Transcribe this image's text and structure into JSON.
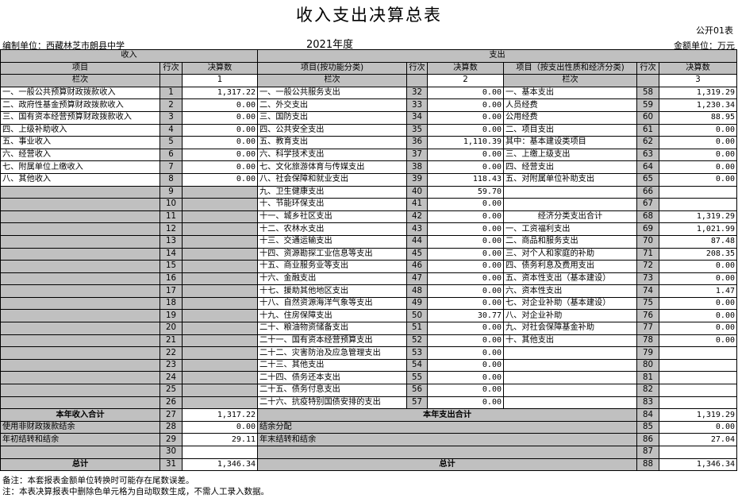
{
  "title": "收入支出决算总表",
  "form_code": "公开01表",
  "unit_label": "编制单位：西藏林芝市朗县中学",
  "year": "2021年度",
  "amount_unit": "金额单位：万元",
  "header": {
    "income": "收入",
    "expense": "支出",
    "item": "项目",
    "row_no": "行次",
    "amount": "决算数",
    "item_func": "项目(按功能分类)",
    "item_econ": "项目（按支出性质和经济分类)",
    "col_label": "栏次",
    "col1": "1",
    "col2": "2",
    "col3": "3"
  },
  "rows": [
    {
      "i_name": "一、一般公共预算财政拨款收入",
      "i_no": "1",
      "i_amt": "1,317.22",
      "f_name": "一、一般公共服务支出",
      "f_no": "32",
      "f_amt": "0.00",
      "e_name": "一、基本支出",
      "e_no": "58",
      "e_amt": "1,319.29"
    },
    {
      "i_name": "二、政府性基金预算财政拨款收入",
      "i_no": "2",
      "i_amt": "0.00",
      "f_name": "二、外交支出",
      "f_no": "33",
      "f_amt": "0.00",
      "e_name": "人员经费",
      "e_no": "59",
      "e_amt": "1,230.34",
      "e_indent": true
    },
    {
      "i_name": "三、国有资本经营预算财政拨款收入",
      "i_no": "3",
      "i_amt": "0.00",
      "f_name": "三、国防支出",
      "f_no": "34",
      "f_amt": "0.00",
      "e_name": "公用经费",
      "e_no": "60",
      "e_amt": "88.95",
      "e_indent": true
    },
    {
      "i_name": "四、上级补助收入",
      "i_no": "4",
      "i_amt": "0.00",
      "f_name": "四、公共安全支出",
      "f_no": "35",
      "f_amt": "0.00",
      "e_name": "二、项目支出",
      "e_no": "61",
      "e_amt": "0.00"
    },
    {
      "i_name": "五、事业收入",
      "i_no": "5",
      "i_amt": "0.00",
      "f_name": "五、教育支出",
      "f_no": "36",
      "f_amt": "1,110.39",
      "e_name": "其中：基本建设类项目",
      "e_no": "62",
      "e_amt": "0.00",
      "e_indent": true
    },
    {
      "i_name": "六、经营收入",
      "i_no": "6",
      "i_amt": "0.00",
      "f_name": "六、科学技术支出",
      "f_no": "37",
      "f_amt": "0.00",
      "e_name": "三、上缴上级支出",
      "e_no": "63",
      "e_amt": "0.00"
    },
    {
      "i_name": "七、附属单位上缴收入",
      "i_no": "7",
      "i_amt": "0.00",
      "f_name": "七、文化旅游体育与传媒支出",
      "f_no": "38",
      "f_amt": "0.00",
      "e_name": "四、经营支出",
      "e_no": "64",
      "e_amt": "0.00"
    },
    {
      "i_name": "八、其他收入",
      "i_no": "8",
      "i_amt": "0.00",
      "f_name": "八、社会保障和就业支出",
      "f_no": "39",
      "f_amt": "118.43",
      "e_name": "五、对附属单位补助支出",
      "e_no": "65",
      "e_amt": "0.00"
    },
    {
      "i_name": "",
      "i_no": "9",
      "i_amt": "",
      "f_name": "九、卫生健康支出",
      "f_no": "40",
      "f_amt": "59.70",
      "e_name": "",
      "e_no": "66",
      "e_amt": ""
    },
    {
      "i_name": "",
      "i_no": "10",
      "i_amt": "",
      "f_name": "十、节能环保支出",
      "f_no": "41",
      "f_amt": "0.00",
      "e_name": "",
      "e_no": "67",
      "e_amt": ""
    },
    {
      "i_name": "",
      "i_no": "11",
      "i_amt": "",
      "f_name": "十一、城乡社区支出",
      "f_no": "42",
      "f_amt": "0.00",
      "e_name": "经济分类支出合计",
      "e_no": "68",
      "e_amt": "1,319.29",
      "e_center": true
    },
    {
      "i_name": "",
      "i_no": "12",
      "i_amt": "",
      "f_name": "十二、农林水支出",
      "f_no": "43",
      "f_amt": "0.00",
      "e_name": "一、工资福利支出",
      "e_no": "69",
      "e_amt": "1,021.99"
    },
    {
      "i_name": "",
      "i_no": "13",
      "i_amt": "",
      "f_name": "十三、交通运输支出",
      "f_no": "44",
      "f_amt": "0.00",
      "e_name": "二、商品和服务支出",
      "e_no": "70",
      "e_amt": "87.48"
    },
    {
      "i_name": "",
      "i_no": "14",
      "i_amt": "",
      "f_name": "十四、资源勘探工业信息等支出",
      "f_no": "45",
      "f_amt": "0.00",
      "e_name": "三、对个人和家庭的补助",
      "e_no": "71",
      "e_amt": "208.35"
    },
    {
      "i_name": "",
      "i_no": "15",
      "i_amt": "",
      "f_name": "十五、商业服务业等支出",
      "f_no": "46",
      "f_amt": "0.00",
      "e_name": "四、债务利息及费用支出",
      "e_no": "72",
      "e_amt": "0.00"
    },
    {
      "i_name": "",
      "i_no": "16",
      "i_amt": "",
      "f_name": "十六、金融支出",
      "f_no": "47",
      "f_amt": "0.00",
      "e_name": "五、资本性支出（基本建设）",
      "e_no": "73",
      "e_amt": "0.00"
    },
    {
      "i_name": "",
      "i_no": "17",
      "i_amt": "",
      "f_name": "十七、援助其他地区支出",
      "f_no": "48",
      "f_amt": "0.00",
      "e_name": "六、资本性支出",
      "e_no": "74",
      "e_amt": "1.47"
    },
    {
      "i_name": "",
      "i_no": "18",
      "i_amt": "",
      "f_name": "十八、自然资源海洋气象等支出",
      "f_no": "49",
      "f_amt": "0.00",
      "e_name": "七、对企业补助（基本建设）",
      "e_no": "75",
      "e_amt": "0.00"
    },
    {
      "i_name": "",
      "i_no": "19",
      "i_amt": "",
      "f_name": "十九、住房保障支出",
      "f_no": "50",
      "f_amt": "30.77",
      "e_name": "八、对企业补助",
      "e_no": "76",
      "e_amt": "0.00"
    },
    {
      "i_name": "",
      "i_no": "20",
      "i_amt": "",
      "f_name": "二十、粮油物资储备支出",
      "f_no": "51",
      "f_amt": "0.00",
      "e_name": "九、对社会保障基金补助",
      "e_no": "77",
      "e_amt": "0.00"
    },
    {
      "i_name": "",
      "i_no": "21",
      "i_amt": "",
      "f_name": "二十一、国有资本经营预算支出",
      "f_no": "52",
      "f_amt": "0.00",
      "e_name": "十、其他支出",
      "e_no": "78",
      "e_amt": "0.00"
    },
    {
      "i_name": "",
      "i_no": "22",
      "i_amt": "",
      "f_name": "二十二、灾害防治及应急管理支出",
      "f_no": "53",
      "f_amt": "0.00",
      "e_name": "",
      "e_no": "79",
      "e_amt": ""
    },
    {
      "i_name": "",
      "i_no": "23",
      "i_amt": "",
      "f_name": "二十三、其他支出",
      "f_no": "54",
      "f_amt": "0.00",
      "e_name": "",
      "e_no": "80",
      "e_amt": ""
    },
    {
      "i_name": "",
      "i_no": "24",
      "i_amt": "",
      "f_name": "二十四、债务还本支出",
      "f_no": "55",
      "f_amt": "0.00",
      "e_name": "",
      "e_no": "81",
      "e_amt": ""
    },
    {
      "i_name": "",
      "i_no": "25",
      "i_amt": "",
      "f_name": "二十五、债务付息支出",
      "f_no": "56",
      "f_amt": "0.00",
      "e_name": "",
      "e_no": "82",
      "e_amt": ""
    },
    {
      "i_name": "",
      "i_no": "26",
      "i_amt": "",
      "f_name": "二十六、抗疫特别国债安排的支出",
      "f_no": "57",
      "f_amt": "0.00",
      "e_name": "",
      "e_no": "83",
      "e_amt": ""
    }
  ],
  "totals": [
    {
      "i_name": "本年收入合计",
      "i_no": "27",
      "i_amt": "1,317.22",
      "e_name": "本年支出合计",
      "e_no": "84",
      "e_amt": "1,319.29",
      "i_bold": true,
      "e_bold": true
    },
    {
      "i_name": "使用非财政拨款结余",
      "i_no": "28",
      "i_amt": "0.00",
      "e_name": "结余分配",
      "e_no": "85",
      "e_amt": "0.00",
      "i_indent": true,
      "e_indent": true
    },
    {
      "i_name": "年初结转和结余",
      "i_no": "29",
      "i_amt": "29.11",
      "e_name": "年末结转和结余",
      "e_no": "86",
      "e_amt": "27.04",
      "i_indent": true,
      "e_indent": true
    },
    {
      "i_name": "",
      "i_no": "30",
      "i_amt": "",
      "e_name": "",
      "e_no": "87",
      "e_amt": ""
    },
    {
      "i_name": "总计",
      "i_no": "31",
      "i_amt": "1,346.34",
      "e_name": "总计",
      "e_no": "88",
      "e_amt": "1,346.34",
      "i_bold": true,
      "e_bold": true
    }
  ],
  "notes": [
    "备注：本套报表金额单位转换时可能存在尾数误差。",
    "注：本表决算报表中删除色单元格为自动取数生成，不需人工录入数据。"
  ]
}
